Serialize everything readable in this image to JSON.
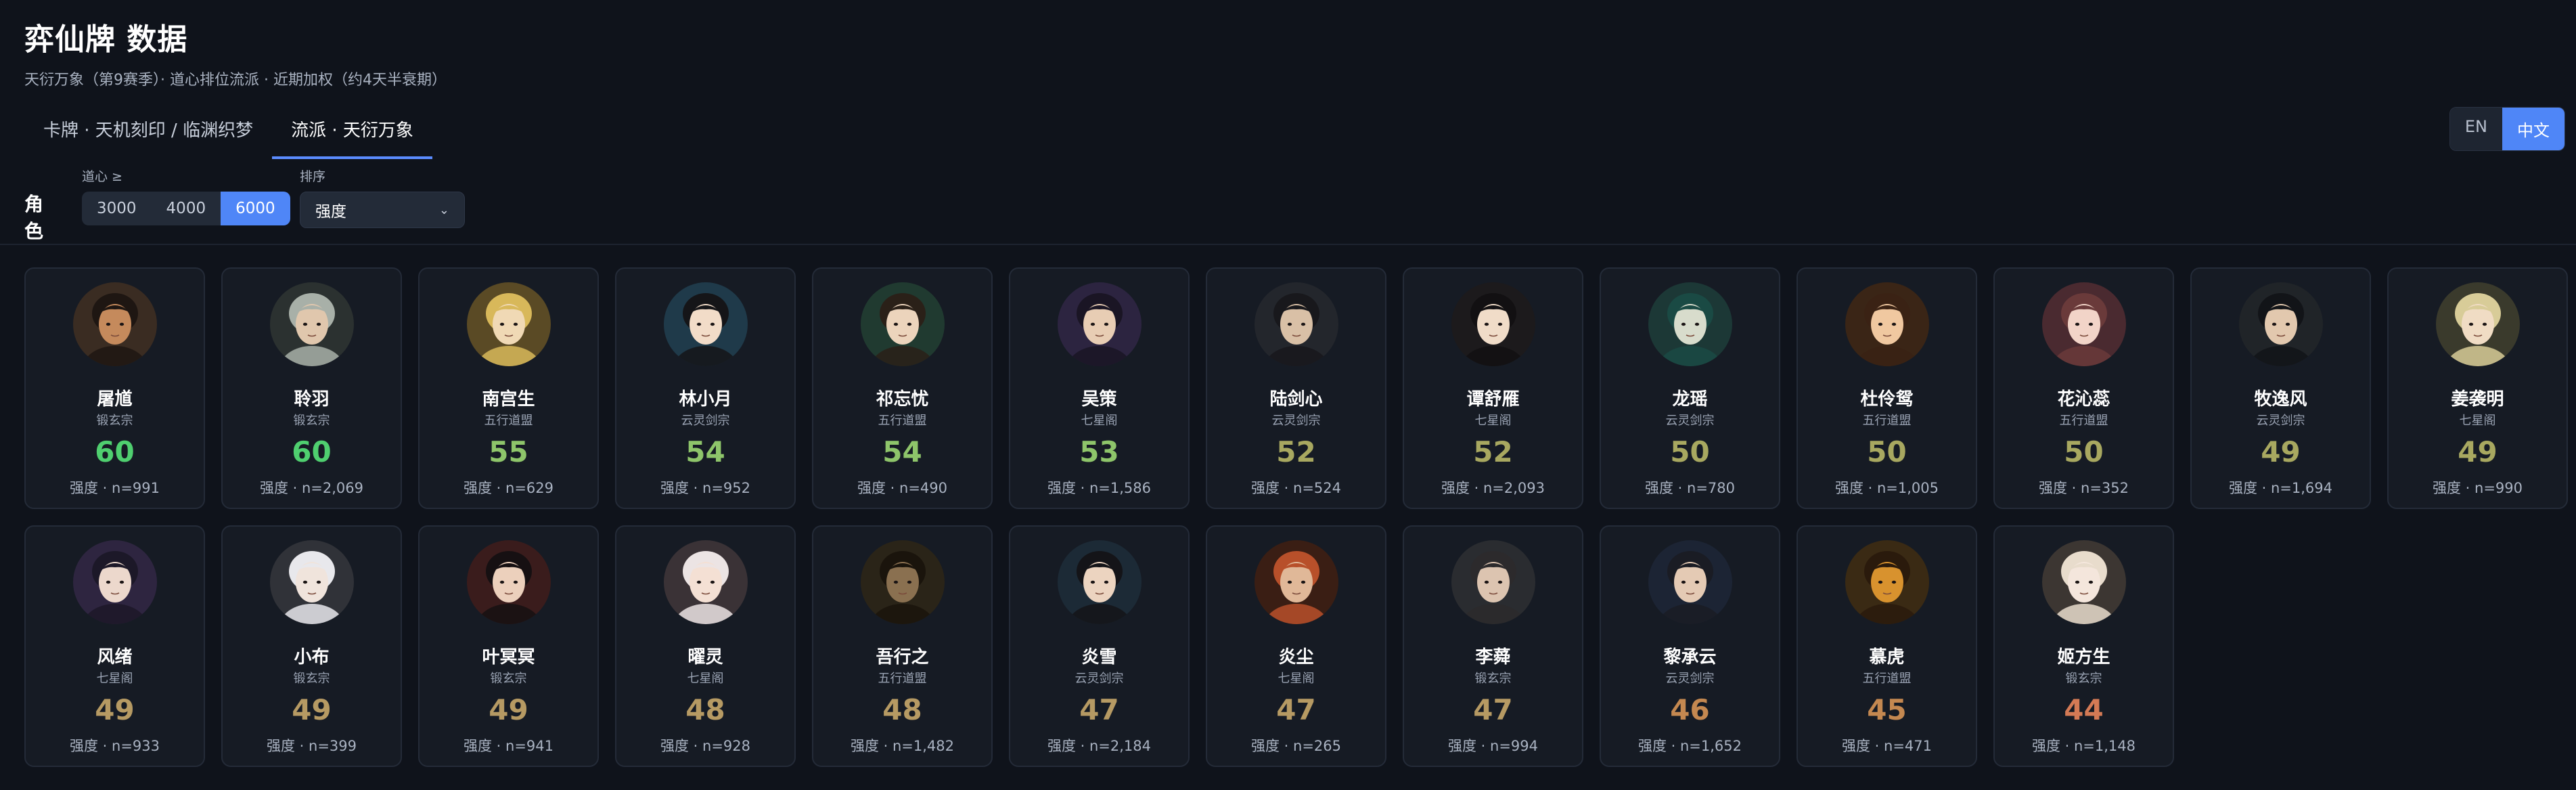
{
  "header": {
    "title": "弈仙牌 数据",
    "subtitle": "天衍万象（第9赛季）· 道心排位流派 · 近期加权（约4天半衰期）"
  },
  "tabs": [
    {
      "label": "卡牌 · 天机刻印 / 临渊织梦",
      "active": false
    },
    {
      "label": "流派 · 天衍万象",
      "active": true
    }
  ],
  "lang": {
    "en": "EN",
    "zh": "中文",
    "selected": "zh"
  },
  "filters": {
    "role_label": "角色",
    "daoxin_label": "道心 ≥",
    "daoxin_options": [
      "3000",
      "4000",
      "6000"
    ],
    "daoxin_selected": "6000",
    "sort_label": "排序",
    "sort_value": "强度"
  },
  "colors": {
    "accent": "#4f86f7",
    "score_high": "#4fcf6f",
    "score_mid": "#8ec56a",
    "score_olive": "#a8a860",
    "score_tan": "#b69a63",
    "score_brown": "#c48850",
    "score_orange": "#d47a55"
  },
  "cards": [
    {
      "name": "屠馗",
      "sect": "锻玄宗",
      "score": "60",
      "meta": "强度 · n=991",
      "tier": "high",
      "icon": "portrait-bearded-warrior",
      "bg": "#3a2c22",
      "face": "#c58a5c",
      "hair": "#1e1612"
    },
    {
      "name": "聆羽",
      "sect": "锻玄宗",
      "score": "60",
      "meta": "强度 · n=2,069",
      "tier": "high",
      "icon": "portrait-silver-hair",
      "bg": "#2b3130",
      "face": "#e0c7ad",
      "hair": "#a8b0a8"
    },
    {
      "name": "南宫生",
      "sect": "五行道盟",
      "score": "55",
      "meta": "强度 · n=629",
      "tier": "mid",
      "icon": "portrait-golden-crown",
      "bg": "#5a4a25",
      "face": "#f0d9b5",
      "hair": "#d8b85a"
    },
    {
      "name": "林小月",
      "sect": "云灵剑宗",
      "score": "54",
      "meta": "强度 · n=952",
      "tier": "mid",
      "icon": "portrait-black-hair-flowers",
      "bg": "#1f3a4a",
      "face": "#f2dcc8",
      "hair": "#151518"
    },
    {
      "name": "祁忘忧",
      "sect": "五行道盟",
      "score": "54",
      "meta": "强度 · n=490",
      "tier": "mid",
      "icon": "portrait-green-ornaments",
      "bg": "#203a30",
      "face": "#ecd4bc",
      "hair": "#2a2018"
    },
    {
      "name": "吴策",
      "sect": "七星阁",
      "score": "53",
      "meta": "强度 · n=1,586",
      "tier": "mid",
      "icon": "portrait-purple-scholar",
      "bg": "#2c2440",
      "face": "#e8cdb4",
      "hair": "#1a1524"
    },
    {
      "name": "陆剑心",
      "sect": "云灵剑宗",
      "score": "52",
      "meta": "强度 · n=524",
      "tier": "olive",
      "icon": "portrait-dark-swordsman",
      "bg": "#23262c",
      "face": "#d9c0a6",
      "hair": "#18181c"
    },
    {
      "name": "谭舒雁",
      "sect": "七星阁",
      "score": "52",
      "meta": "强度 · n=2,093",
      "tier": "olive",
      "icon": "portrait-lady-hairpin",
      "bg": "#1c1a1c",
      "face": "#f0dcc8",
      "hair": "#121012"
    },
    {
      "name": "龙瑶",
      "sect": "云灵剑宗",
      "score": "50",
      "meta": "强度 · n=780",
      "tier": "olive",
      "icon": "portrait-teal-dragon",
      "bg": "#1c3836",
      "face": "#d8dccc",
      "hair": "#1a4a44"
    },
    {
      "name": "杜伶鸳",
      "sect": "五行道盟",
      "score": "50",
      "meta": "强度 · n=1,005",
      "tier": "olive",
      "icon": "portrait-orange-dancer",
      "bg": "#3a2516",
      "face": "#f0c8a0",
      "hair": "#3a2214"
    },
    {
      "name": "花沁蕊",
      "sect": "五行道盟",
      "score": "50",
      "meta": "强度 · n=352",
      "tier": "olive",
      "icon": "portrait-pink-flowers",
      "bg": "#4a2a30",
      "face": "#f2d4c8",
      "hair": "#6a3a3a"
    },
    {
      "name": "牧逸风",
      "sect": "云灵剑宗",
      "score": "49",
      "meta": "强度 · n=1,694",
      "tier": "olive",
      "icon": "portrait-dark-hair-youth",
      "bg": "#202428",
      "face": "#e2c8ae",
      "hair": "#121418"
    },
    {
      "name": "姜袭明",
      "sect": "七星阁",
      "score": "49",
      "meta": "强度 · n=990",
      "tier": "olive",
      "icon": "portrait-blond-youth",
      "bg": "#3a3a2c",
      "face": "#f0dcc4",
      "hair": "#d8cc98"
    },
    {
      "name": "风绪",
      "sect": "七星阁",
      "score": "49",
      "meta": "强度 · n=933",
      "tier": "tan",
      "icon": "portrait-violet-lady",
      "bg": "#2e2540",
      "face": "#ecd8cc",
      "hair": "#1c1828"
    },
    {
      "name": "小布",
      "sect": "锻玄宗",
      "score": "49",
      "meta": "强度 · n=399",
      "tier": "tan",
      "icon": "portrait-white-hair-horns",
      "bg": "#303238",
      "face": "#f0e4dc",
      "hair": "#e8e8ec"
    },
    {
      "name": "叶冥冥",
      "sect": "锻玄宗",
      "score": "49",
      "meta": "强度 · n=941",
      "tier": "tan",
      "icon": "portrait-red-dark-lady",
      "bg": "#3a1c1c",
      "face": "#ecd0bc",
      "hair": "#161012"
    },
    {
      "name": "曜灵",
      "sect": "七星阁",
      "score": "48",
      "meta": "强度 · n=928",
      "tier": "tan",
      "icon": "portrait-white-hair-girl",
      "bg": "#3a3236",
      "face": "#f4e0d4",
      "hair": "#ece4e4"
    },
    {
      "name": "吾行之",
      "sect": "五行道盟",
      "score": "48",
      "meta": "强度 · n=1,482",
      "tier": "tan",
      "icon": "portrait-shadowed-elder",
      "bg": "#2a2418",
      "face": "#8a7050",
      "hair": "#1a140c"
    },
    {
      "name": "炎雪",
      "sect": "云灵剑宗",
      "score": "47",
      "meta": "强度 · n=2,184",
      "tier": "tan",
      "icon": "portrait-dark-haired-woman",
      "bg": "#1c2a36",
      "face": "#ecd4c0",
      "hair": "#141418"
    },
    {
      "name": "炎尘",
      "sect": "七星阁",
      "score": "47",
      "meta": "强度 · n=265",
      "tier": "tan",
      "icon": "portrait-red-hair-man",
      "bg": "#3a1e14",
      "face": "#e0b898",
      "hair": "#b8502a"
    },
    {
      "name": "李蕣",
      "sect": "锻玄宗",
      "score": "47",
      "meta": "强度 · n=994",
      "tier": "tan",
      "icon": "portrait-grey-youth",
      "bg": "#2a2c30",
      "face": "#dcc4b0",
      "hair": "#2c2a2c"
    },
    {
      "name": "黎承云",
      "sect": "云灵剑宗",
      "score": "46",
      "meta": "强度 · n=1,652",
      "tier": "brown",
      "icon": "portrait-navy-scholar",
      "bg": "#1c2434",
      "face": "#e4cab4",
      "hair": "#1a1c24"
    },
    {
      "name": "慕虎",
      "sect": "五行道盟",
      "score": "45",
      "meta": "强度 · n=471",
      "tier": "brown",
      "icon": "portrait-tiger",
      "bg": "#3a2a14",
      "face": "#d8922e",
      "hair": "#2a1a0c"
    },
    {
      "name": "姬方生",
      "sect": "锻玄宗",
      "score": "44",
      "meta": "强度 · n=1,148",
      "tier": "orange",
      "icon": "portrait-pale-blond",
      "bg": "#3c3632",
      "face": "#f4e6dc",
      "hair": "#e8dccc"
    }
  ]
}
